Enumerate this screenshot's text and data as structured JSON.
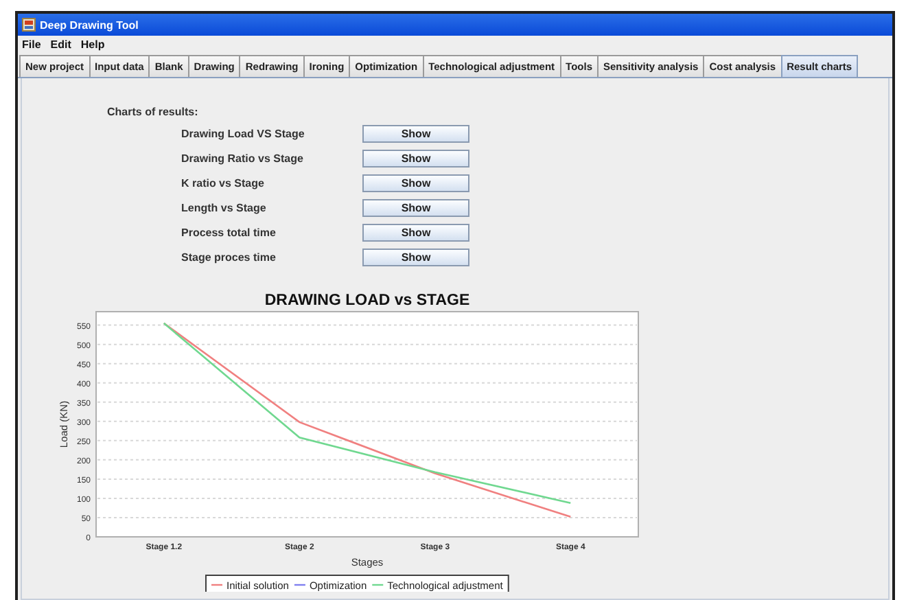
{
  "window": {
    "title": "Deep Drawing Tool"
  },
  "menu": [
    "File",
    "Edit",
    "Help"
  ],
  "tabs": [
    {
      "label": "New project",
      "selected": false
    },
    {
      "label": "Input data",
      "selected": false
    },
    {
      "label": "Blank",
      "selected": false
    },
    {
      "label": "Drawing",
      "selected": false
    },
    {
      "label": "Redrawing",
      "selected": false
    },
    {
      "label": "Ironing",
      "selected": false
    },
    {
      "label": "Optimization",
      "selected": false
    },
    {
      "label": "Technological adjustment",
      "selected": false
    },
    {
      "label": "Tools",
      "selected": false
    },
    {
      "label": "Sensitivity analysis",
      "selected": false
    },
    {
      "label": "Cost analysis",
      "selected": false
    },
    {
      "label": "Result charts",
      "selected": true
    }
  ],
  "charts_heading": "Charts of results:",
  "chart_rows": [
    {
      "label": "Drawing Load VS Stage",
      "button": "Show"
    },
    {
      "label": "Drawing Ratio vs Stage",
      "button": "Show"
    },
    {
      "label": "K ratio vs Stage",
      "button": "Show"
    },
    {
      "label": "Length vs Stage",
      "button": "Show"
    },
    {
      "label": "Process total time",
      "button": "Show"
    },
    {
      "label": "Stage proces time",
      "button": "Show"
    }
  ],
  "chart": {
    "chart_data": {
      "type": "line",
      "title": "DRAWING LOAD vs STAGE",
      "xlabel": "Stages",
      "ylabel": "Load (KN)",
      "categories": [
        "Stage 1.2",
        "Stage 2",
        "Stage 3",
        "Stage 4"
      ],
      "series": [
        {
          "name": "Initial solution",
          "color": "#f08080",
          "values": [
            555,
            298,
            165,
            52
          ]
        },
        {
          "name": "Optimization",
          "color": "#8080f0",
          "values": [
            null,
            null,
            null,
            null
          ]
        },
        {
          "name": "Technological adjustment",
          "color": "#70d890",
          "values": [
            555,
            258,
            168,
            88
          ]
        }
      ],
      "ylim": [
        0,
        585
      ],
      "grid": true,
      "legend": true,
      "yticks": [
        0,
        50,
        100,
        150,
        200,
        250,
        300,
        350,
        400,
        450,
        500,
        550
      ]
    }
  }
}
